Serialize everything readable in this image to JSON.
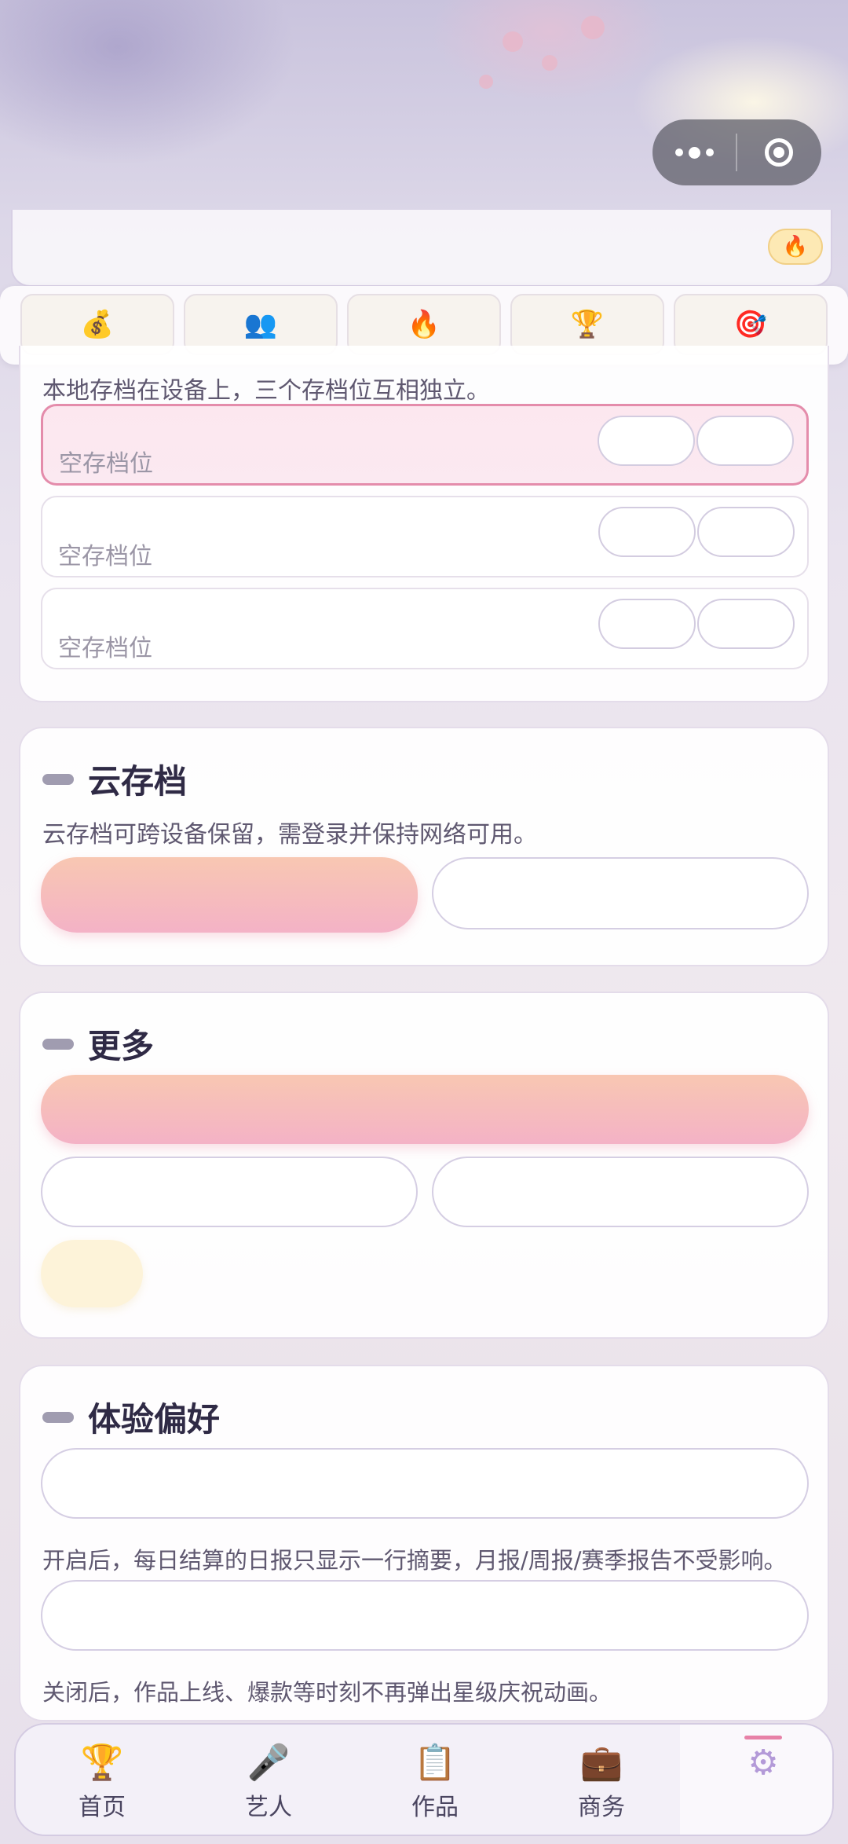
{
  "topbar": {
    "fire_icon": "🔥"
  },
  "quick_icons": [
    "💰",
    "👥",
    "🔥",
    "🏆",
    "🎯"
  ],
  "local_save": {
    "description": "本地存档在设备上，三个存档位互相独立。",
    "slots": [
      {
        "label": "空存档位"
      },
      {
        "label": "空存档位"
      },
      {
        "label": "空存档位"
      }
    ]
  },
  "cloud_save": {
    "title": "云存档",
    "description": "云存档可跨设备保留，需登录并保持网络可用。"
  },
  "more": {
    "title": "更多"
  },
  "preferences": {
    "title": "体验偏好",
    "desc1": "开启后，每日结算的日报只显示一行摘要，月报/周报/赛季报告不受影响。",
    "desc2": "关闭后，作品上线、爆款等时刻不再弹出星级庆祝动画。"
  },
  "tabbar": {
    "tabs": [
      {
        "label": "首页",
        "icon": "🏆"
      },
      {
        "label": "艺人",
        "icon": "🎤"
      },
      {
        "label": "作品",
        "icon": "📋"
      },
      {
        "label": "商务",
        "icon": "💼"
      },
      {
        "label": "",
        "icon": "⚙"
      }
    ]
  }
}
